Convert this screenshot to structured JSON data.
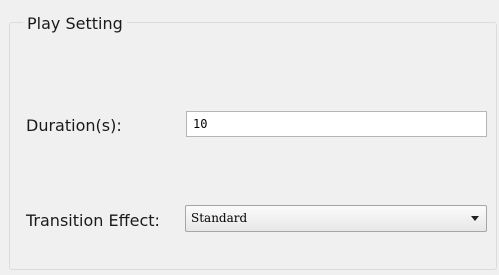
{
  "group": {
    "title": "Play Setting"
  },
  "duration": {
    "label": "Duration(s):",
    "value": "10"
  },
  "transition": {
    "label": "Transition Effect:",
    "selected": "Standard"
  }
}
